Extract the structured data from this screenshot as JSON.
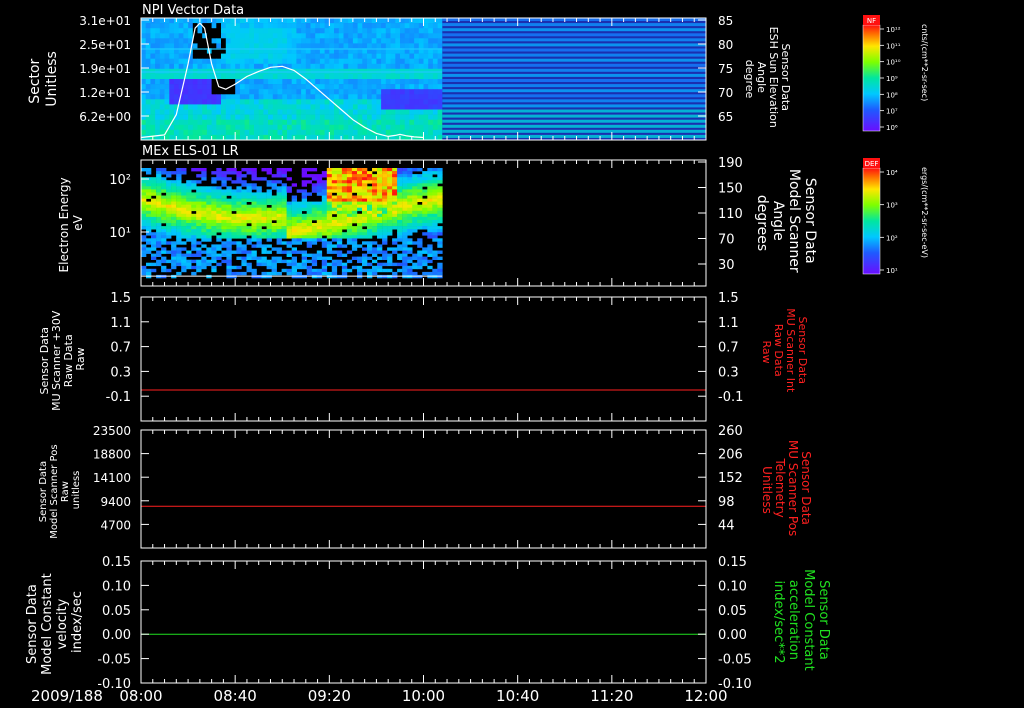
{
  "date_label": "2009/188",
  "time_ticks": [
    "08:00",
    "08:40",
    "09:20",
    "10:00",
    "10:40",
    "11:20",
    "12:00"
  ],
  "chart_data": [
    {
      "id": "p1",
      "type": "heatmap",
      "title": "NPI Vector Data",
      "left_label_lines": [
        "Sector",
        "Unitless"
      ],
      "left_ticks": [
        "3.1e+01",
        "2.5e+01",
        "1.9e+01",
        "1.2e+01",
        "6.2e+00"
      ],
      "right_label_lines": [
        "Sensor Data",
        "ESH Sun Elevation",
        "Angle",
        "degree"
      ],
      "right_ticks": [
        "85",
        "80",
        "75",
        "70",
        "65"
      ],
      "right_ylim": [
        61,
        85
      ],
      "line_series": {
        "color": "#ffffff",
        "x_minutes": [
          0,
          10,
          15,
          20,
          23,
          25,
          27,
          30,
          33,
          36,
          40,
          45,
          50,
          55,
          60,
          65,
          70,
          75,
          80,
          85,
          90,
          95,
          100,
          105,
          108,
          110,
          113,
          116,
          120
        ],
        "values": [
          61.5,
          62,
          66,
          76,
          83,
          84,
          83,
          76,
          71.5,
          71,
          72,
          73.5,
          74.5,
          75.3,
          75.5,
          74.7,
          73,
          71,
          69,
          67,
          65,
          63.5,
          62.3,
          61.7,
          61.9,
          62.1,
          61.8,
          61.6,
          61.5
        ]
      },
      "colorbar": {
        "title": "NF",
        "units": "cnts/(cm**2-sr-sec)",
        "tick_labels": [
          "10¹²",
          "10¹¹",
          "10¹⁰",
          "10⁹",
          "10⁸",
          "10⁷",
          "10⁶"
        ]
      }
    },
    {
      "id": "p2",
      "type": "heatmap",
      "title": "MEx ELS-01 LR",
      "left_label_lines": [
        "Electron Energy",
        "eV"
      ],
      "left_ticks": [
        "10²",
        "10¹"
      ],
      "right_label_lines": [
        "Sensor Data",
        "Model Scanner",
        "Angle",
        "degrees"
      ],
      "right_ticks": [
        "190",
        "150",
        "110",
        "70",
        "30"
      ],
      "right_ylim": [
        0,
        190
      ],
      "line_series": {
        "color": "#ffffff",
        "x_minutes": [
          0,
          128
        ],
        "values": [
          15,
          15
        ]
      },
      "colorbar": {
        "title": "DEF",
        "units": "ergs/(cm**2-sr-sec-eV)",
        "tick_labels": [
          "10⁴",
          "10³",
          "10²",
          "10¹"
        ]
      }
    },
    {
      "id": "p3",
      "type": "line",
      "left_label_lines": [
        "Sensor Data",
        "MU Scanner +30V",
        "Raw Data",
        "Raw"
      ],
      "left_ticks": [
        "1.5",
        "1.1",
        "0.7",
        "0.3",
        "-0.1"
      ],
      "left_ylim": [
        -0.5,
        1.5
      ],
      "right_label_lines": [
        "Sensor Data",
        "MU Scanner Int",
        "Raw Data",
        "Raw"
      ],
      "right_ticks": [
        "1.5",
        "1.1",
        "0.7",
        "0.3",
        "-0.1"
      ],
      "right_color": "#ff2020",
      "series": [
        {
          "color": "#ff2020",
          "values": [
            0.0,
            0.0
          ]
        }
      ]
    },
    {
      "id": "p4",
      "type": "line",
      "left_label_lines": [
        "Sensor Data",
        "Model Scanner Pos",
        "Raw",
        "unitless"
      ],
      "left_ticks": [
        "23500",
        "18800",
        "14100",
        "9400",
        "4700"
      ],
      "left_ylim": [
        0,
        23500
      ],
      "right_label_lines": [
        "Sensor Data",
        "MU Scanner Pos",
        "Telemetry",
        "Unitless"
      ],
      "right_ticks": [
        "260",
        "206",
        "152",
        "98",
        "44"
      ],
      "right_color": "#ff2020",
      "series": [
        {
          "color": "#ff2020",
          "values": [
            8300,
            8300
          ]
        }
      ]
    },
    {
      "id": "p5",
      "type": "line",
      "left_label_lines": [
        "Sensor Data",
        "Model Constant",
        "velocity",
        "index/sec"
      ],
      "left_ticks": [
        "0.15",
        "0.10",
        "0.05",
        "0.00",
        "-0.05",
        "-0.10"
      ],
      "left_ylim": [
        -0.1,
        0.15
      ],
      "right_label_lines": [
        "Sensor Data",
        "Model Constant",
        "acceleration",
        "index/sec**2"
      ],
      "right_ticks": [
        "0.15",
        "0.10",
        "0.05",
        "0.00",
        "-0.05",
        "-0.10"
      ],
      "right_color": "#20e020",
      "series": [
        {
          "color": "#20e020",
          "values": [
            0.0,
            0.0
          ]
        }
      ]
    }
  ]
}
